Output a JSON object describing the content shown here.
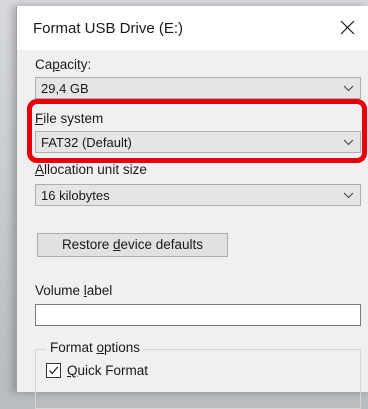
{
  "window": {
    "title": "Format USB Drive (E:)"
  },
  "capacity": {
    "label_pre": "Ca",
    "label_key": "p",
    "label_post": "acity:",
    "value": "29,4 GB"
  },
  "file_system": {
    "label_key": "F",
    "label_post": "ile system",
    "value": "FAT32 (Default)"
  },
  "allocation": {
    "label_key": "A",
    "label_post": "llocation unit size",
    "value": "16 kilobytes"
  },
  "restore_button": {
    "label_pre": "Restore ",
    "label_key": "d",
    "label_post": "evice defaults"
  },
  "volume": {
    "label_pre": "Volume ",
    "label_key": "l",
    "label_post": "abel",
    "value": ""
  },
  "format_options": {
    "title_pre": "Format ",
    "title_key": "o",
    "title_post": "ptions",
    "quick_format": {
      "label_key": "Q",
      "label_post": "uick Format",
      "checked": true
    }
  },
  "icons": {
    "close": "close-icon",
    "dropdown": "chevron-down-icon",
    "check": "checkmark-icon"
  },
  "colors": {
    "highlight": "#e8000c",
    "dialog_bg": "#f0f0f0"
  }
}
